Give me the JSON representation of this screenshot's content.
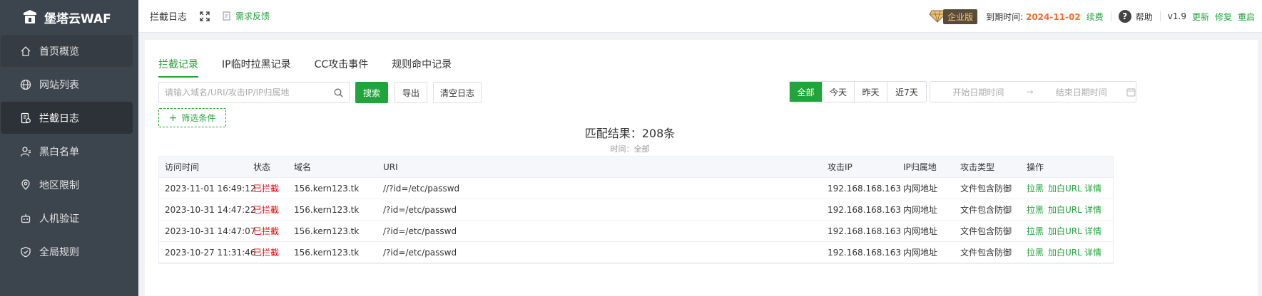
{
  "app": {
    "brand": "堡塔云WAF"
  },
  "sidebar": {
    "items": [
      {
        "label": "首页概览",
        "icon": "home-icon"
      },
      {
        "label": "网站列表",
        "icon": "globe-icon"
      },
      {
        "label": "拦截日志",
        "icon": "log-icon"
      },
      {
        "label": "黑白名单",
        "icon": "user-list-icon"
      },
      {
        "label": "地区限制",
        "icon": "location-icon"
      },
      {
        "label": "人机验证",
        "icon": "robot-icon"
      },
      {
        "label": "全局规则",
        "icon": "shield-icon"
      }
    ]
  },
  "header": {
    "title": "拦截日志",
    "feedback": "需求反馈",
    "edition": "企业版",
    "expire_label": "到期时间:",
    "expire_date": "2024-11-02",
    "renew": "续费",
    "help": "帮助",
    "version": "v1.9",
    "update": "更新",
    "repair": "修复",
    "restart": "重启"
  },
  "tabs": [
    "拦截记录",
    "IP临时拉黑记录",
    "CC攻击事件",
    "规则命中记录"
  ],
  "toolbar": {
    "search_placeholder": "请输入域名/URI/攻击IP/IP归属地",
    "search": "搜索",
    "export": "导出",
    "clear": "清空日志",
    "filter": "筛选条件",
    "ranges": [
      "全部",
      "今天",
      "昨天",
      "近7天"
    ],
    "start_placeholder": "开始日期时间",
    "end_placeholder": "结束日期时间"
  },
  "result": {
    "title": "匹配结果：208条",
    "subtitle": "时间：全部"
  },
  "table": {
    "headers": [
      "访问时间",
      "状态",
      "域名",
      "URI",
      "攻击IP",
      "IP归属地",
      "攻击类型",
      "操作"
    ],
    "rows": [
      {
        "time": "2023-11-01 16:49:12",
        "status": "已拦截",
        "domain": "156.kern123.tk",
        "uri": "//?id=/etc/passwd",
        "ip": "192.168.168.163",
        "region": "内网地址",
        "type": "文件包含防御"
      },
      {
        "time": "2023-10-31 14:47:22",
        "status": "已拦截",
        "domain": "156.kern123.tk",
        "uri": "/?id=/etc/passwd",
        "ip": "192.168.168.163",
        "region": "内网地址",
        "type": "文件包含防御"
      },
      {
        "time": "2023-10-31 14:47:07",
        "status": "已拦截",
        "domain": "156.kern123.tk",
        "uri": "/?id=/etc/passwd",
        "ip": "192.168.168.163",
        "region": "内网地址",
        "type": "文件包含防御"
      },
      {
        "time": "2023-10-27 11:31:46",
        "status": "已拦截",
        "domain": "156.kern123.tk",
        "uri": "/?id=/etc/passwd",
        "ip": "192.168.168.163",
        "region": "内网地址",
        "type": "文件包含防御"
      }
    ],
    "actions": [
      "拉黑",
      "加白URL",
      "详情"
    ]
  },
  "colors": {
    "accent": "#20a53a",
    "sidebar": "#3c444d",
    "blocked": "#ff0000",
    "expire": "#fc6d26"
  }
}
